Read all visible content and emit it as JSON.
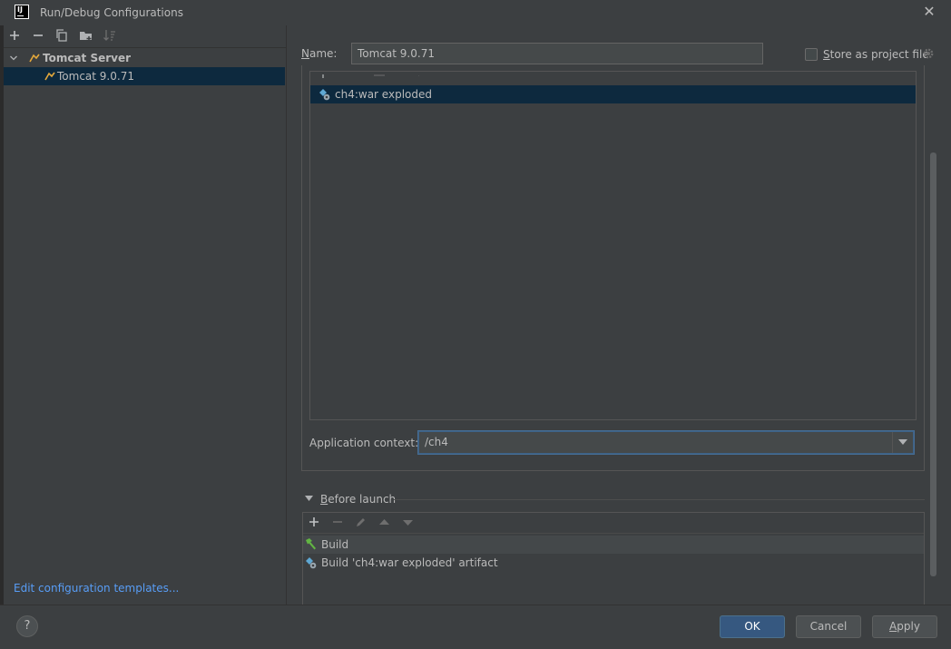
{
  "window": {
    "title": "Run/Debug Configurations",
    "app_icon": "intellij-icon",
    "close_icon": "close-icon"
  },
  "left_toolbar": {
    "buttons": [
      {
        "name": "add",
        "icon": "plus-icon",
        "glyph": "+"
      },
      {
        "name": "remove",
        "icon": "minus-icon",
        "glyph": "−"
      },
      {
        "name": "copy",
        "icon": "copy-icon"
      },
      {
        "name": "folder",
        "icon": "new-folder-icon"
      },
      {
        "name": "sort",
        "icon": "sort-icon"
      }
    ]
  },
  "tree": {
    "group_label": "Tomcat Server",
    "items": [
      {
        "label": "Tomcat 9.0.71",
        "selected": true
      }
    ]
  },
  "edit_templates_link": "Edit configuration templates...",
  "form": {
    "name_label": "Name:",
    "name_value": "Tomcat 9.0.71",
    "store_label": "Store as project file",
    "store_checked": false
  },
  "deployment": {
    "items": [
      {
        "label": "ch4:war exploded",
        "selected": true
      }
    ],
    "app_context_label": "Application context:",
    "app_context_value": "/ch4"
  },
  "before_launch": {
    "title": "Before launch",
    "tasks": [
      {
        "label": "Build",
        "icon": "hammer-icon"
      },
      {
        "label": "Build 'ch4:war exploded' artifact",
        "icon": "artifact-icon"
      }
    ]
  },
  "buttons": {
    "help": "?",
    "ok": "OK",
    "cancel": "Cancel",
    "apply": "Apply"
  },
  "colors": {
    "background": "#3c3f41",
    "selection": "#0d293e",
    "link": "#589df6",
    "primary_button": "#365880"
  }
}
